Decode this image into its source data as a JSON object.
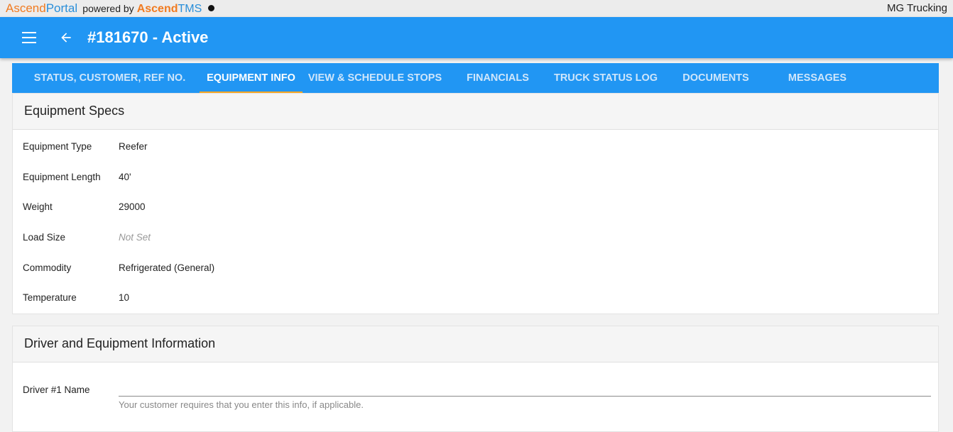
{
  "topbar": {
    "brand_ascend": "Ascend",
    "brand_portal": "Portal",
    "powered_by": "powered by",
    "brand_ascend2": "Ascend",
    "brand_tms": "TMS",
    "company": "MG Trucking"
  },
  "appbar": {
    "title": "#181670 - Active",
    "color": "#2196f3"
  },
  "tabs": [
    {
      "label": "STATUS, CUSTOMER, REF NO.",
      "active": false
    },
    {
      "label": "EQUIPMENT INFO",
      "active": true
    },
    {
      "label": "VIEW & SCHEDULE STOPS",
      "active": false
    },
    {
      "label": "FINANCIALS",
      "active": false
    },
    {
      "label": "TRUCK STATUS LOG",
      "active": false
    },
    {
      "label": "DOCUMENTS",
      "active": false
    },
    {
      "label": "MESSAGES",
      "active": false
    }
  ],
  "equipment_specs": {
    "title": "Equipment Specs",
    "rows": [
      {
        "label": "Equipment Type",
        "value": "Reefer"
      },
      {
        "label": "Equipment Length",
        "value": "40'"
      },
      {
        "label": "Weight",
        "value": "29000"
      },
      {
        "label": "Load Size",
        "value": "Not Set"
      },
      {
        "label": "Commodity",
        "value": "Refrigerated (General)"
      },
      {
        "label": "Temperature",
        "value": "10"
      }
    ]
  },
  "driver_info": {
    "title": "Driver and Equipment Information",
    "driver1_label": "Driver #1 Name",
    "driver1_value": "",
    "driver1_hint": "Your customer requires that you enter this info, if applicable."
  }
}
